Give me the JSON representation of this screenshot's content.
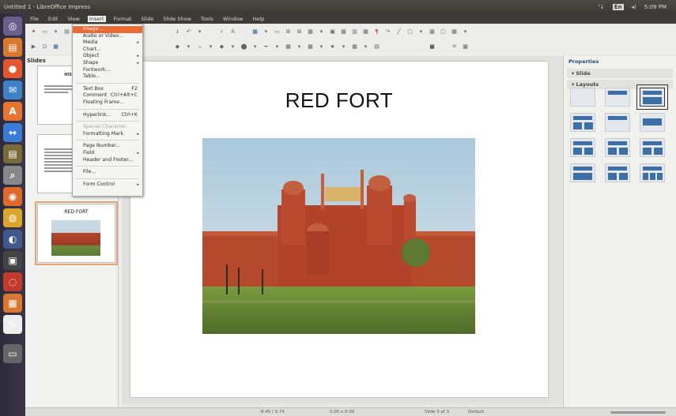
{
  "window": {
    "title": "Untitled 1 - LibreOffice Impress",
    "tray": {
      "kb": "ᵀ↓",
      "box": "En",
      "sound": "◂)",
      "time": "5:09 PM"
    }
  },
  "menubar": [
    "File",
    "Edit",
    "View",
    "Insert",
    "Format",
    "Slide",
    "Slide Show",
    "Tools",
    "Window",
    "Help"
  ],
  "launcher_icons": [
    "dash-icon",
    "files-icon",
    "firefox-icon",
    "thunderbird-icon",
    "app-icon",
    "impress-icon",
    "app-icon",
    "app-icon",
    "app-icon",
    "app-icon",
    "app-icon",
    "app-icon",
    "app-icon",
    "app-icon",
    "app-icon",
    "trash-icon"
  ],
  "slides_pane": {
    "header": "Slides",
    "slide1": {
      "num": "1",
      "title": "HISTORICA"
    },
    "slide2": {
      "num": "2",
      "title": "RED"
    },
    "slide3": {
      "num": "3",
      "title": "RED FORT"
    }
  },
  "slide": {
    "title": "RED FORT"
  },
  "properties": {
    "header": "Properties",
    "slide_section": "Slide",
    "layouts_section": "Layouts"
  },
  "insert_menu": [
    {
      "label": "Image...",
      "highlight": true
    },
    {
      "label": "Audio or Video..."
    },
    {
      "label": "Media",
      "submenu": true
    },
    {
      "label": "Chart..."
    },
    {
      "label": "Object",
      "submenu": true
    },
    {
      "label": "Shape",
      "submenu": true
    },
    {
      "label": "Fontwork..."
    },
    {
      "label": "Table..."
    },
    {
      "sep": true
    },
    {
      "label": "Text Box",
      "shortcut": "F2"
    },
    {
      "label": "Comment",
      "shortcut": "Ctrl+Alt+C"
    },
    {
      "label": "Floating Frame..."
    },
    {
      "sep": true
    },
    {
      "label": "Hyperlink...",
      "shortcut": "Ctrl+K"
    },
    {
      "sep": true
    },
    {
      "label": "Special Character...",
      "disabled": true
    },
    {
      "label": "Formatting Mark",
      "submenu": true
    },
    {
      "sep": true
    },
    {
      "label": "Page Number..."
    },
    {
      "label": "Field",
      "submenu": true
    },
    {
      "label": "Header and Footer..."
    },
    {
      "sep": true
    },
    {
      "label": "File..."
    },
    {
      "sep": true
    },
    {
      "label": "Form Control",
      "submenu": true
    }
  ],
  "statusbar": {
    "pos": "-8.45 / 9.74",
    "size": "0.00 x 0.00",
    "slide": "Slide 3 of 3",
    "master": "Default"
  }
}
